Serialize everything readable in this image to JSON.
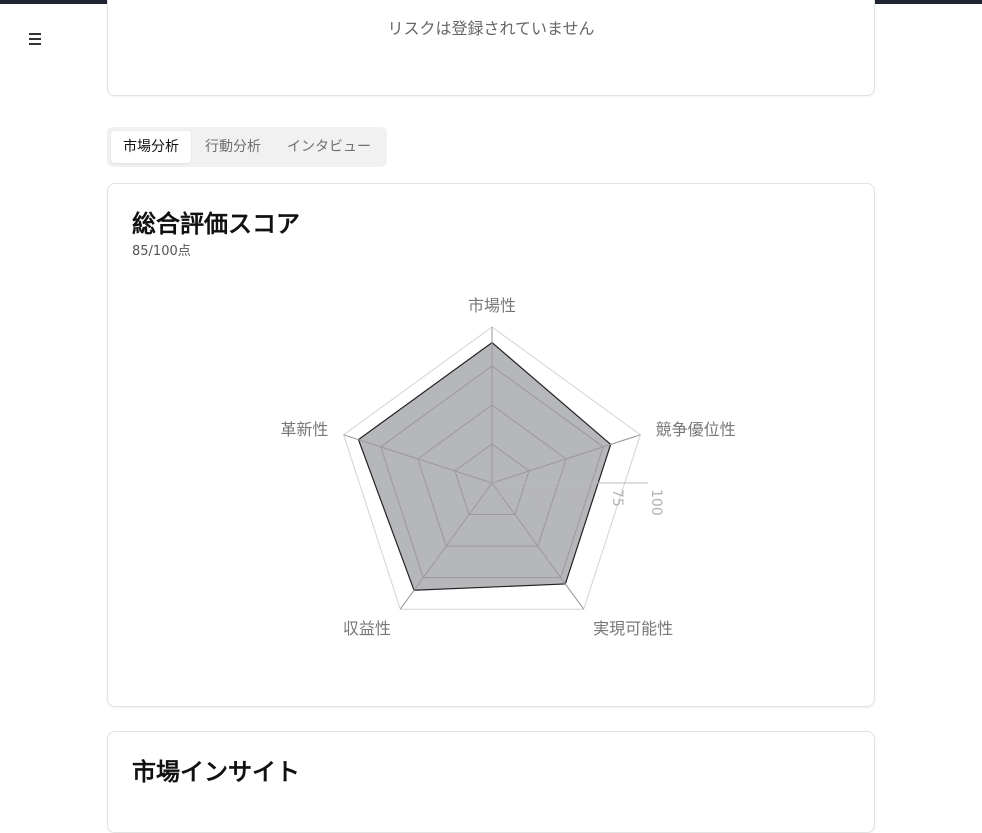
{
  "risk": {
    "empty_text": "リスクは登録されていません"
  },
  "tabs": [
    {
      "label": "市場分析",
      "active": true
    },
    {
      "label": "行動分析",
      "active": false
    },
    {
      "label": "インタビュー",
      "active": false
    }
  ],
  "score_card": {
    "title": "総合評価スコア",
    "subtitle": "85/100点"
  },
  "chart_data": {
    "type": "radar",
    "categories": [
      "市場性",
      "競争優位性",
      "実現可能性",
      "収益性",
      "革新性"
    ],
    "series": [
      {
        "values": [
          90,
          80,
          80,
          85,
          90
        ]
      }
    ],
    "rlim": [
      0,
      100
    ],
    "ticks": [
      "0",
      "25",
      "50",
      "75",
      "100"
    ],
    "grid": true,
    "fill_color": "#a9aaae",
    "stroke_color": "#222222"
  },
  "insight_card": {
    "title": "市場インサイト"
  }
}
